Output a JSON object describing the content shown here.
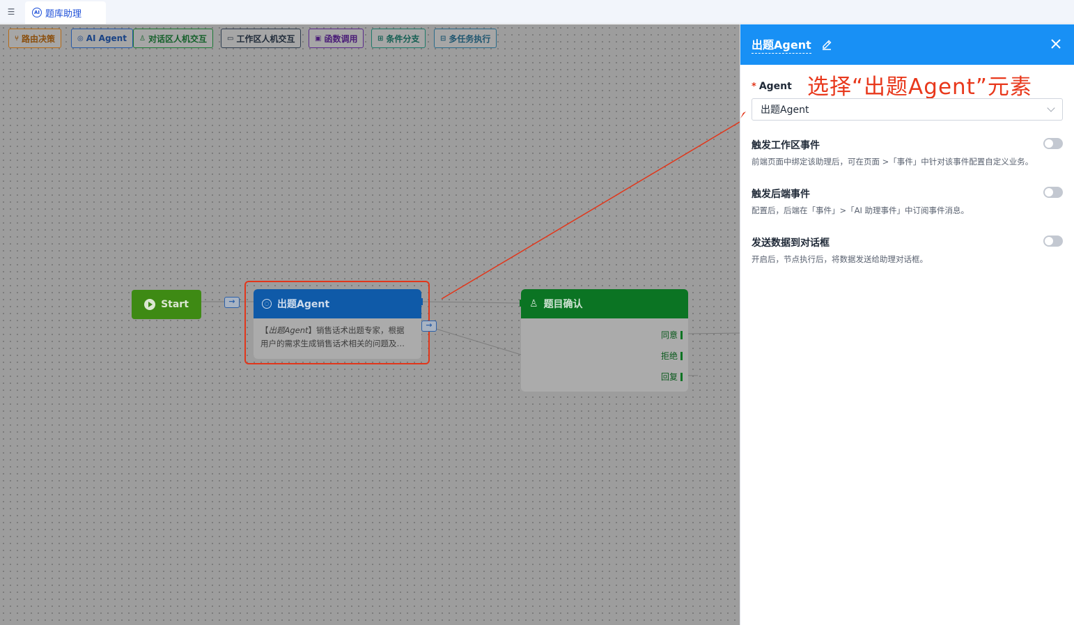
{
  "tabs": [
    {
      "label": "题库助理",
      "icon": "ai-icon"
    }
  ],
  "toolbar": {
    "items": [
      {
        "label": "路由决策",
        "icon": "branch-icon"
      },
      {
        "label": "AI Agent",
        "icon": "ai-agent-icon"
      },
      {
        "label": "对话区人机交互",
        "icon": "user-chat-icon"
      },
      {
        "label": "工作区人机交互",
        "icon": "monitor-icon"
      },
      {
        "label": "函数调用",
        "icon": "function-icon"
      },
      {
        "label": "条件分支",
        "icon": "condition-icon"
      },
      {
        "label": "多任务执行",
        "icon": "multitask-icon"
      }
    ]
  },
  "nodes": {
    "start": {
      "label": "Start"
    },
    "agent": {
      "label": "出题Agent",
      "desc_prefix": "【",
      "desc_em": "出题Agent",
      "desc_line1_rest": "】销售话术出题专家，根据",
      "desc_line2": "用户的需求生成销售话术相关的问题及…"
    },
    "confirm": {
      "label": "题目确认",
      "outputs": [
        "同意",
        "拒绝",
        "回复"
      ]
    }
  },
  "panel": {
    "title": "出题Agent",
    "annotation": "选择“出题Agent”元素",
    "agent_field": {
      "label": "Agent",
      "required_mark": "*",
      "value": "出题Agent"
    },
    "options": [
      {
        "title": "触发工作区事件",
        "desc": "前端页面中绑定该助理后，可在页面 >「事件」中针对该事件配置自定义业务。",
        "enabled": false
      },
      {
        "title": "触发后端事件",
        "desc": "配置后，后端在「事件」>「AI 助理事件」中订阅事件消息。",
        "enabled": false
      },
      {
        "title": "发送数据到对话框",
        "desc": "开启后，节点执行后，将数据发送给助理对话框。",
        "enabled": false
      }
    ]
  },
  "colors": {
    "primary": "#1890f5",
    "annotation": "#e8381c",
    "start_node": "#3e8a14",
    "agent_node": "#0f5aa8",
    "confirm_node": "#0b7423"
  }
}
